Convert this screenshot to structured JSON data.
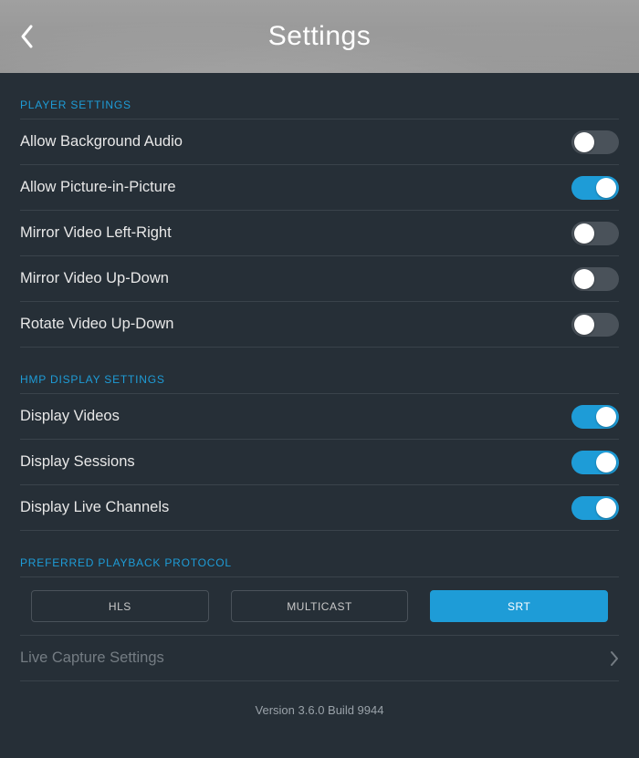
{
  "header": {
    "title": "Settings"
  },
  "sections": {
    "player": {
      "title": "PLAYER SETTINGS",
      "items": [
        {
          "label": "Allow Background Audio",
          "value": false
        },
        {
          "label": "Allow Picture-in-Picture",
          "value": true
        },
        {
          "label": "Mirror Video Left-Right",
          "value": false
        },
        {
          "label": "Mirror Video Up-Down",
          "value": false
        },
        {
          "label": "Rotate Video Up-Down",
          "value": false
        }
      ]
    },
    "hmp": {
      "title": "HMP DISPLAY SETTINGS",
      "items": [
        {
          "label": "Display Videos",
          "value": true
        },
        {
          "label": "Display Sessions",
          "value": true
        },
        {
          "label": "Display Live Channels",
          "value": true
        }
      ]
    },
    "protocol": {
      "title": "PREFERRED PLAYBACK PROTOCOL",
      "options": [
        {
          "label": "HLS",
          "selected": false
        },
        {
          "label": "MULTICAST",
          "selected": false
        },
        {
          "label": "SRT",
          "selected": true
        }
      ]
    }
  },
  "nav": {
    "live_capture": "Live Capture Settings"
  },
  "footer": {
    "version": "Version 3.6.0 Build 9944"
  }
}
